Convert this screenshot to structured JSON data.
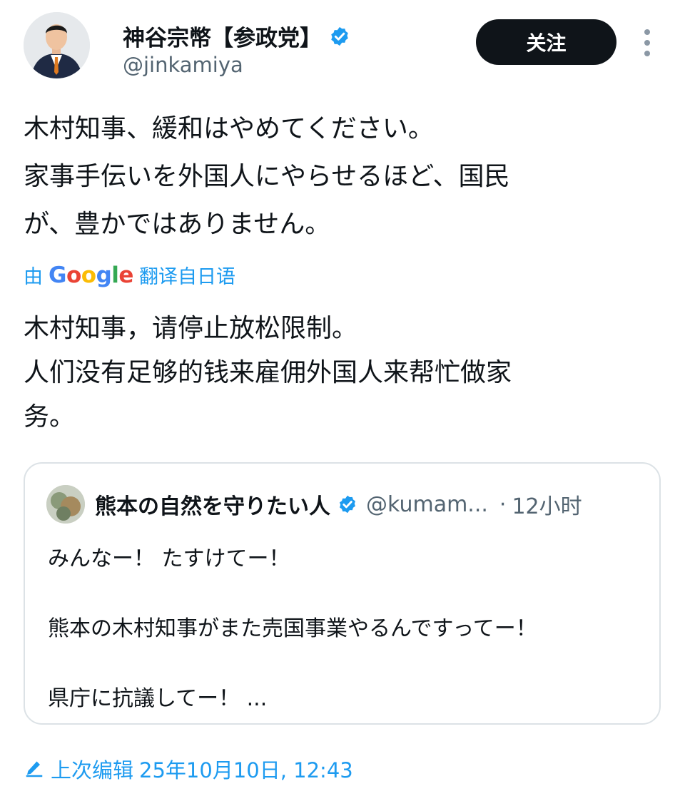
{
  "author": {
    "name": "神谷宗幣【参政党】",
    "handle": "@jinkamiya",
    "follow_label": "关注"
  },
  "tweet": {
    "lines": [
      "木村知事、緩和はやめてください。",
      "家事手伝いを外国人にやらせるほど、国民",
      "が、豊かではありません。"
    ]
  },
  "translation": {
    "prefix": "由",
    "provider": "Google",
    "suffix": "翻译自日语",
    "lines": [
      "木村知事，请停止放松限制。",
      "人们没有足够的钱来雇佣外国人来帮忙做家",
      "务。"
    ]
  },
  "quote": {
    "name": "熊本の自然を守りたい人",
    "handle": "@kumam...",
    "separator": "·",
    "time": "12小时",
    "lines": [
      "みんなー！ たすけてー！",
      "熊本の木村知事がまた売国事業やるんですってー！",
      "県庁に抗議してー！ ..."
    ]
  },
  "footer": {
    "edit_label": "上次编辑",
    "edit_date": "25年10月10日, 12:43"
  },
  "icons": {
    "verified": "verified-badge-icon",
    "more": "more-vertical-icon",
    "pencil": "pencil-icon"
  },
  "colors": {
    "accent": "#1d9bf0",
    "text": "#0f1419",
    "muted": "#536471",
    "button": "#0f1419",
    "border": "#dce2e6"
  }
}
